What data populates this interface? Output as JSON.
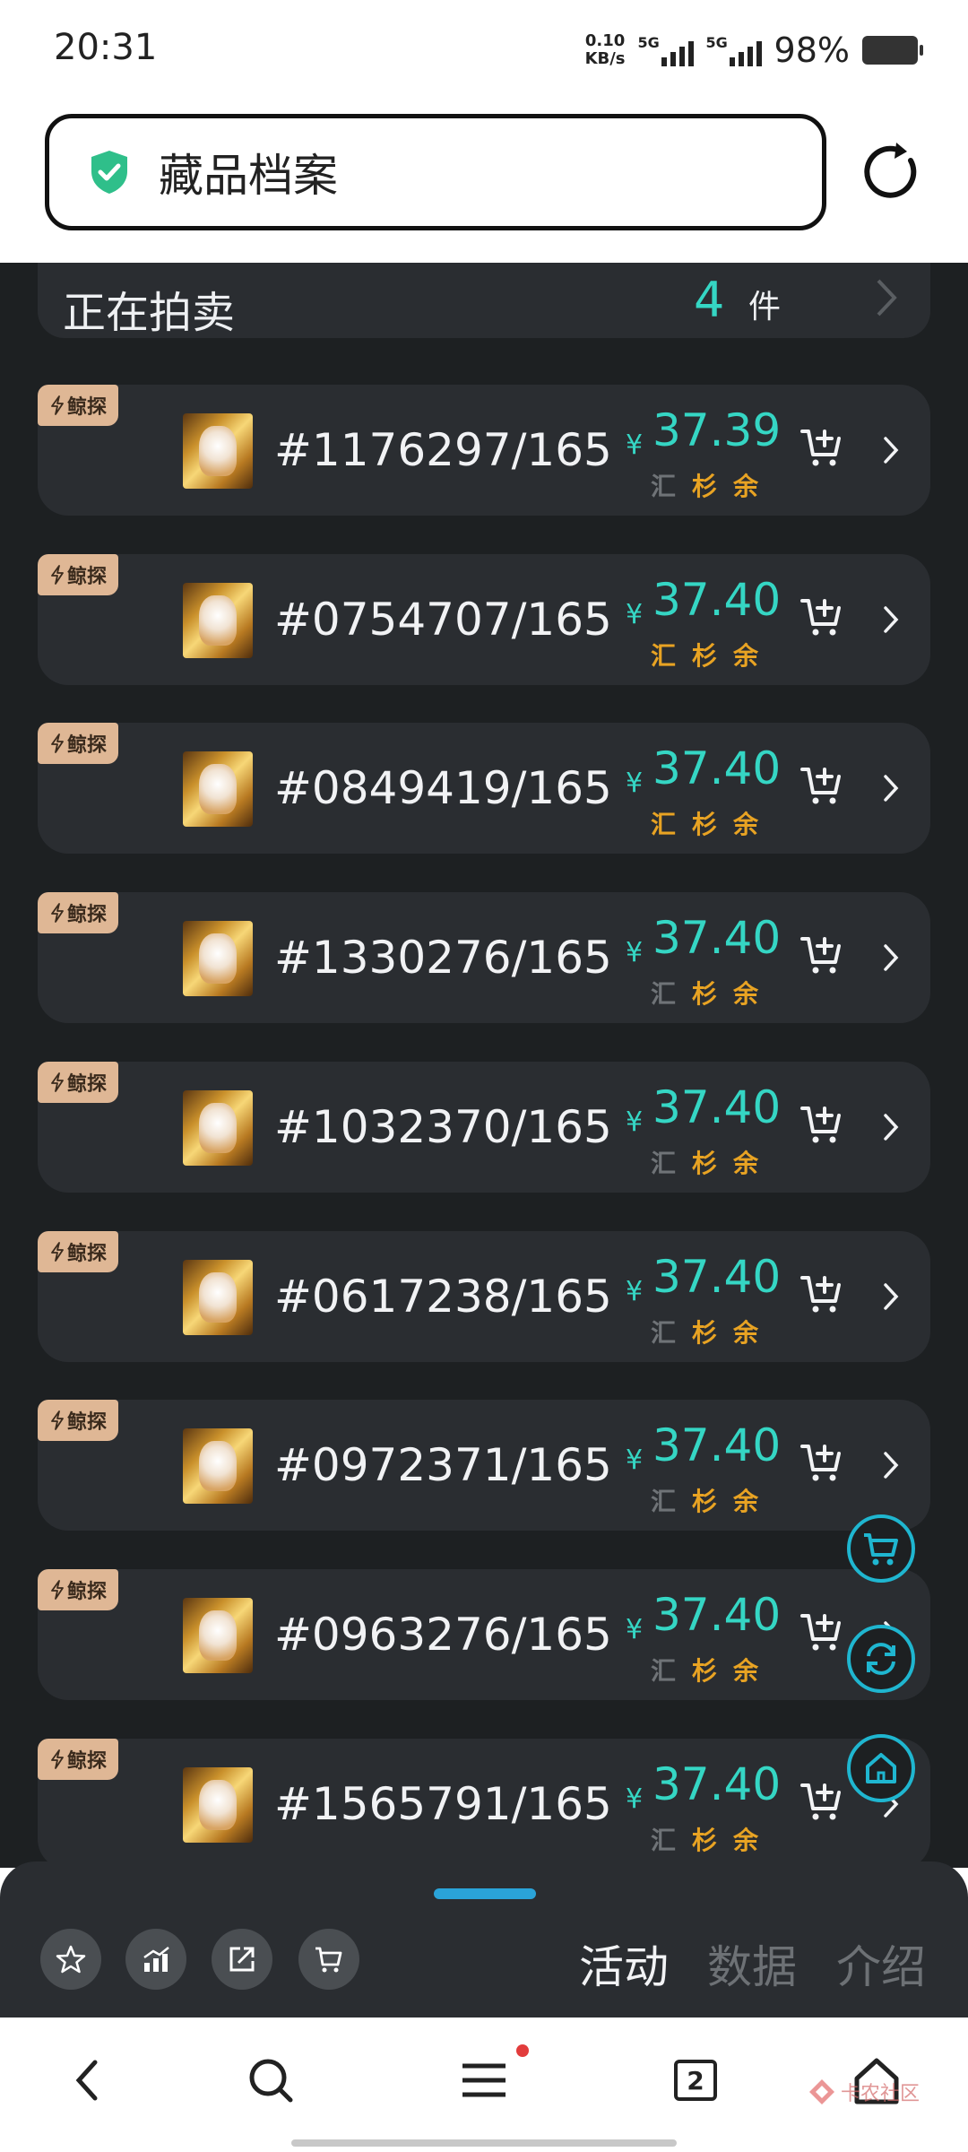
{
  "status_bar": {
    "time": "20:31",
    "net_speed": "0.10",
    "net_unit": "KB/s",
    "sim1": "5G",
    "sim2": "5G",
    "battery": "98%"
  },
  "header": {
    "title": "藏品档案",
    "shield_color": "#2fbf8a"
  },
  "auction": {
    "label": "正在拍卖",
    "count": "4",
    "unit": "件"
  },
  "listings": [
    {
      "tag": "鲸探",
      "serial": "#1176297/165",
      "currency": "¥",
      "price": "37.39",
      "platforms": [
        "汇",
        "杉",
        "余"
      ],
      "active": [
        false,
        true,
        true
      ]
    },
    {
      "tag": "鲸探",
      "serial": "#0754707/165",
      "currency": "¥",
      "price": "37.40",
      "platforms": [
        "汇",
        "杉",
        "余"
      ],
      "active": [
        true,
        true,
        true
      ]
    },
    {
      "tag": "鲸探",
      "serial": "#0849419/165",
      "currency": "¥",
      "price": "37.40",
      "platforms": [
        "汇",
        "杉",
        "余"
      ],
      "active": [
        true,
        true,
        true
      ]
    },
    {
      "tag": "鲸探",
      "serial": "#1330276/165",
      "currency": "¥",
      "price": "37.40",
      "platforms": [
        "汇",
        "杉",
        "余"
      ],
      "active": [
        false,
        true,
        true
      ]
    },
    {
      "tag": "鲸探",
      "serial": "#1032370/165",
      "currency": "¥",
      "price": "37.40",
      "platforms": [
        "汇",
        "杉",
        "余"
      ],
      "active": [
        false,
        true,
        true
      ]
    },
    {
      "tag": "鲸探",
      "serial": "#0617238/165",
      "currency": "¥",
      "price": "37.40",
      "platforms": [
        "汇",
        "杉",
        "余"
      ],
      "active": [
        false,
        true,
        true
      ]
    },
    {
      "tag": "鲸探",
      "serial": "#0972371/165",
      "currency": "¥",
      "price": "37.40",
      "platforms": [
        "汇",
        "杉",
        "余"
      ],
      "active": [
        false,
        true,
        true
      ]
    },
    {
      "tag": "鲸探",
      "serial": "#0963276/165",
      "currency": "¥",
      "price": "37.40",
      "platforms": [
        "汇",
        "杉",
        "余"
      ],
      "active": [
        false,
        true,
        true
      ]
    },
    {
      "tag": "鲸探",
      "serial": "#1565791/165",
      "currency": "¥",
      "price": "37.40",
      "platforms": [
        "汇",
        "杉",
        "余"
      ],
      "active": [
        false,
        true,
        true
      ]
    }
  ],
  "bottom_panel": {
    "tabs": [
      {
        "label": "活动",
        "active": true
      },
      {
        "label": "数据",
        "active": false
      },
      {
        "label": "介绍",
        "active": false
      }
    ],
    "icons": [
      "star-icon",
      "chart-icon",
      "share-icon",
      "cart-icon"
    ]
  },
  "nav_bar": {
    "tab_count": "2",
    "watermark": "卡农社区"
  },
  "colors": {
    "accent_teal": "#35d6c4",
    "platform_active": "#e8a323",
    "platform_inactive": "#6f7377",
    "tag_bg": "#dfb795",
    "fab_border": "#1fb6d0",
    "drag_handle": "#2aa3d8"
  }
}
